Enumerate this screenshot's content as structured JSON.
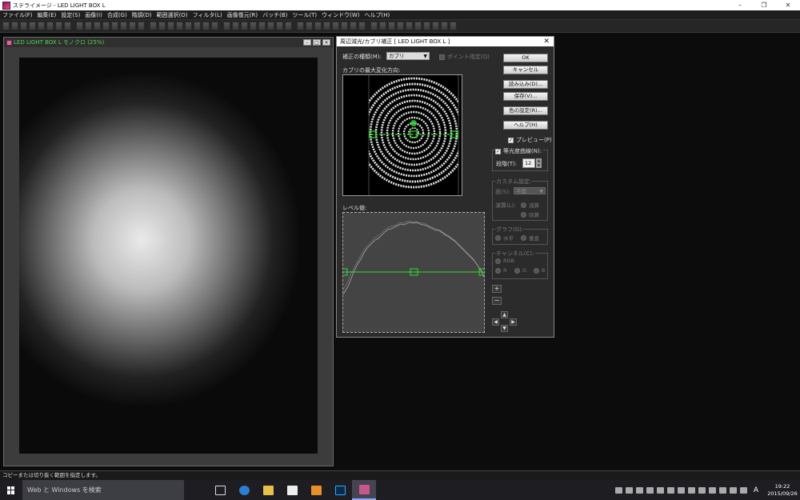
{
  "app": {
    "title": "ステライメージ - LED LIGHT BOX L",
    "window_controls": [
      "–",
      "❐",
      "✕"
    ]
  },
  "menu": [
    "ファイル(F)",
    "編集(E)",
    "設定(S)",
    "画像(I)",
    "合成(G)",
    "階調(D)",
    "範囲選択(O)",
    "フィルタ(L)",
    "画像復元(R)",
    "バッチ(B)",
    "ツール(T)",
    "ウィンドウ(W)",
    "ヘルプ(H)"
  ],
  "image_window": {
    "title": "LED LIGHT BOX L モノクロ (25%)",
    "buttons": [
      "–",
      "□",
      "✕"
    ]
  },
  "dialog": {
    "title": "周辺減光/カブリ補正 [ LED LIGHT BOX L ]",
    "close": "✕",
    "correction_type_label": "補正の種類(M):",
    "correction_type_value": "カブリ",
    "point_spec_label": "ポイント指定(Q)",
    "max_direction_label": "カブリの最大変化方向:",
    "level_label": "レベル値:",
    "buttons": {
      "ok": "OK",
      "cancel": "キャンセル",
      "load": "読み込み(D)...",
      "save": "保存(V)...",
      "color": "色の設定(R)...",
      "help": "ヘルプ(H)"
    },
    "preview_label": "プレビュー(P)",
    "contour_label": "等光度曲線(N):",
    "steps_label": "段階(T):",
    "steps_value": "12",
    "custom_group": "カスタム設定:",
    "surface_label": "面(S):",
    "surface_value": "平面",
    "calc_label": "演算(L):",
    "calc_options": [
      "減算",
      "除算"
    ],
    "graph_group": "グラフ(G):",
    "graph_options": [
      "水平",
      "垂直"
    ],
    "channel_group": "チャンネル(C):",
    "channel_options": [
      "RGB",
      "R",
      "G",
      "B"
    ],
    "plus": "+",
    "minus": "−",
    "arrows": {
      "up": "▲",
      "down": "▼",
      "left": "◀",
      "right": "▶"
    }
  },
  "status_bar": "コピーまたは切り抜く範囲を指定します。",
  "taskbar": {
    "search_placeholder": "Web と Windows を検索",
    "time": "19:22",
    "date": "2015/09/26",
    "ime": "A"
  }
}
